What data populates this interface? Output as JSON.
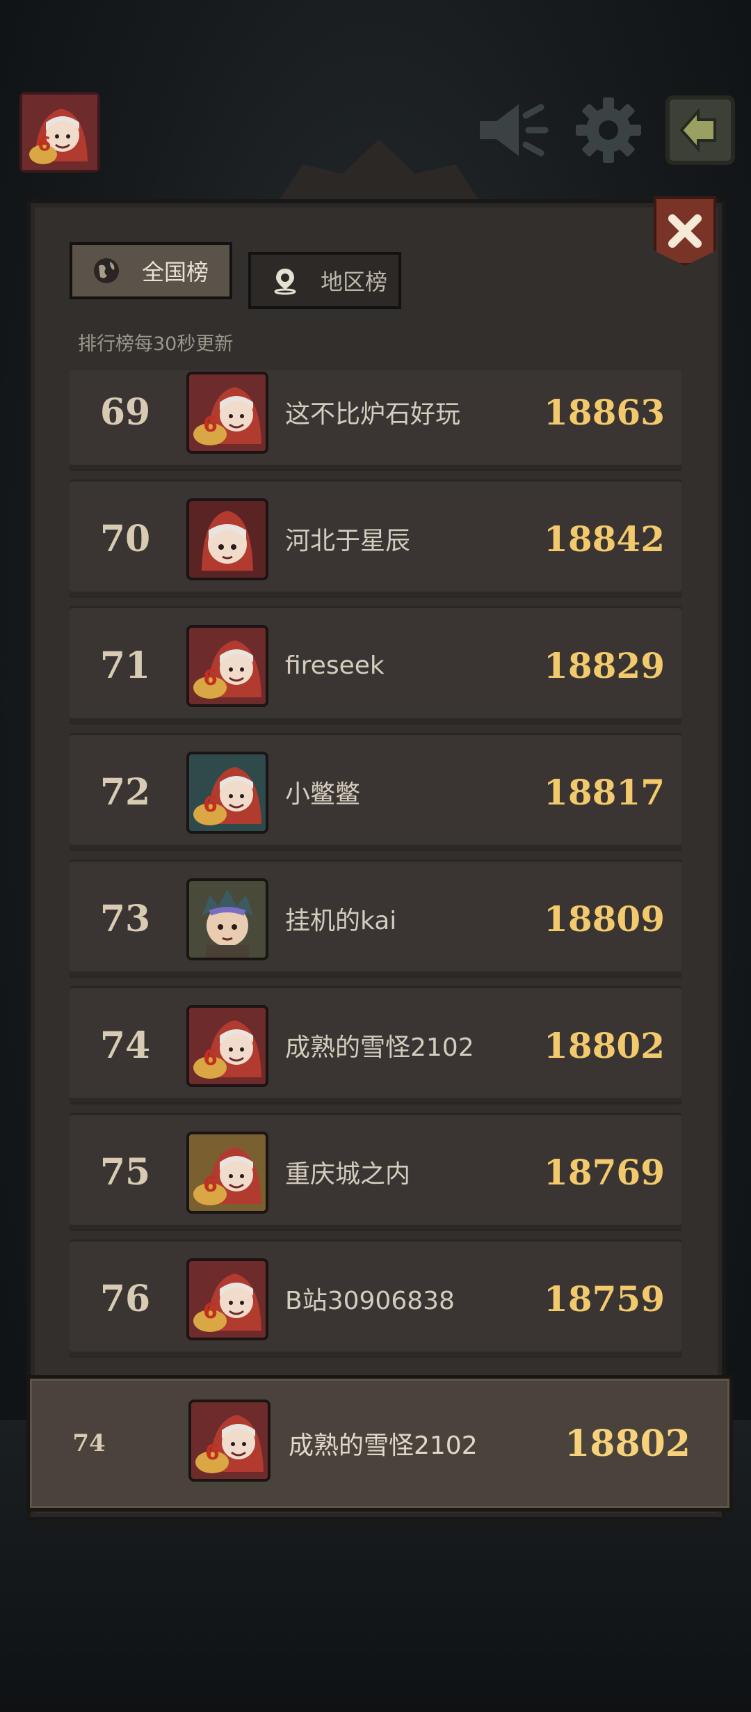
{
  "tabs": {
    "national_label": "全国榜",
    "region_label": "地区榜"
  },
  "update_note": "排行榜每30秒更新",
  "leaderboard": [
    {
      "rank": "69",
      "name": "这不比炉石好玩",
      "score": "18863",
      "avatar": "red-hood-girl-cake-avatar",
      "frame": "#7a2e2e"
    },
    {
      "rank": "70",
      "name": "河北于星辰",
      "score": "18842",
      "avatar": "red-hood-girl-avatar",
      "frame": "#5a2424"
    },
    {
      "rank": "71",
      "name": "fireseek",
      "score": "18829",
      "avatar": "red-hood-girl-cake-avatar",
      "frame": "#7a2e2e"
    },
    {
      "rank": "72",
      "name": "小鳖鳖",
      "score": "18817",
      "avatar": "red-hood-girl-cake-avatar",
      "frame": "#2f4a4a"
    },
    {
      "rank": "73",
      "name": "挂机的kai",
      "score": "18809",
      "avatar": "blue-hair-boy-avatar",
      "frame": "#6b5a2a"
    },
    {
      "rank": "74",
      "name": "成熟的雪怪2102",
      "score": "18802",
      "avatar": "red-hood-girl-cake-avatar",
      "frame": "#7a2e2e"
    },
    {
      "rank": "75",
      "name": "重庆城之内",
      "score": "18769",
      "avatar": "red-hood-girl-cake-avatar",
      "frame": "#8a6a2a"
    },
    {
      "rank": "76",
      "name": "B站30906838",
      "score": "18759",
      "avatar": "red-hood-girl-cake-avatar",
      "frame": "#7a2e2e"
    }
  ],
  "my_rank": {
    "rank": "74",
    "name": "成熟的雪怪2102",
    "score": "18802"
  },
  "icons": [
    "player-avatar-icon",
    "sound-icon",
    "gear-icon",
    "exit-icon",
    "close-icon",
    "globe-icon",
    "location-pin-icon"
  ],
  "colors": {
    "score": "#f2c96c",
    "close_button": "#7a3327",
    "tab_active": "#5b5349"
  }
}
